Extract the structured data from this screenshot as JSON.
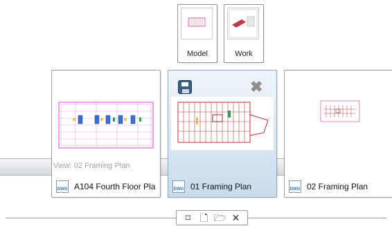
{
  "layouts": {
    "model": {
      "label": "Model"
    },
    "work": {
      "label": "Work"
    }
  },
  "drawings": [
    {
      "name": "A104 Fourth Floor Pla",
      "icon_text": "DWG",
      "active": false
    },
    {
      "name": "01 Framing Plan",
      "icon_text": "DWG",
      "active": true
    },
    {
      "name": "02 Framing Plan",
      "icon_text": "DWG",
      "active": false
    }
  ],
  "tooltip": {
    "text": "View: 02 Framing Plan"
  },
  "colors": {
    "accent": "#c9dceb",
    "plan_magenta": "#e040e0",
    "plan_red": "#b03030",
    "save_icon": "#3f5f82"
  },
  "icons": {
    "save": "save-disk-icon",
    "close": "close-icon",
    "pin": "pin-icon",
    "new": "new-document-icon",
    "open": "open-folder-icon",
    "close_bar": "close-icon"
  },
  "toolbar": {
    "pin_glyph": "⌑",
    "new_glyph": "🗋",
    "open_glyph": "🗁",
    "close_glyph": "✕"
  }
}
